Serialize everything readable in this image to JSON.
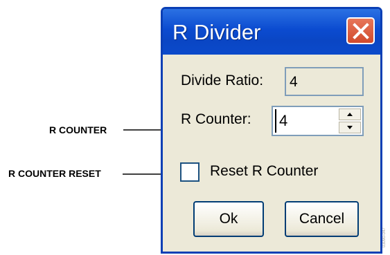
{
  "dialog": {
    "title": "R Divider",
    "divide_ratio_label": "Divide Ratio:",
    "divide_ratio_value": "4",
    "r_counter_label": "R Counter:",
    "r_counter_value": "4",
    "reset_label": "Reset R Counter",
    "reset_checked": false,
    "ok_label": "Ok",
    "cancel_label": "Cancel"
  },
  "callouts": {
    "r_counter": "R COUNTER",
    "r_counter_reset": "R COUNTER RESET"
  },
  "icons": {
    "close": "close-icon",
    "spin_up": "spin-up-icon",
    "spin_down": "spin-down-icon"
  },
  "colors": {
    "titlebar": "#0b4bd0",
    "close_button": "#d14a2c",
    "dialog_face": "#ece9d8"
  },
  "watermark": "03090-047"
}
